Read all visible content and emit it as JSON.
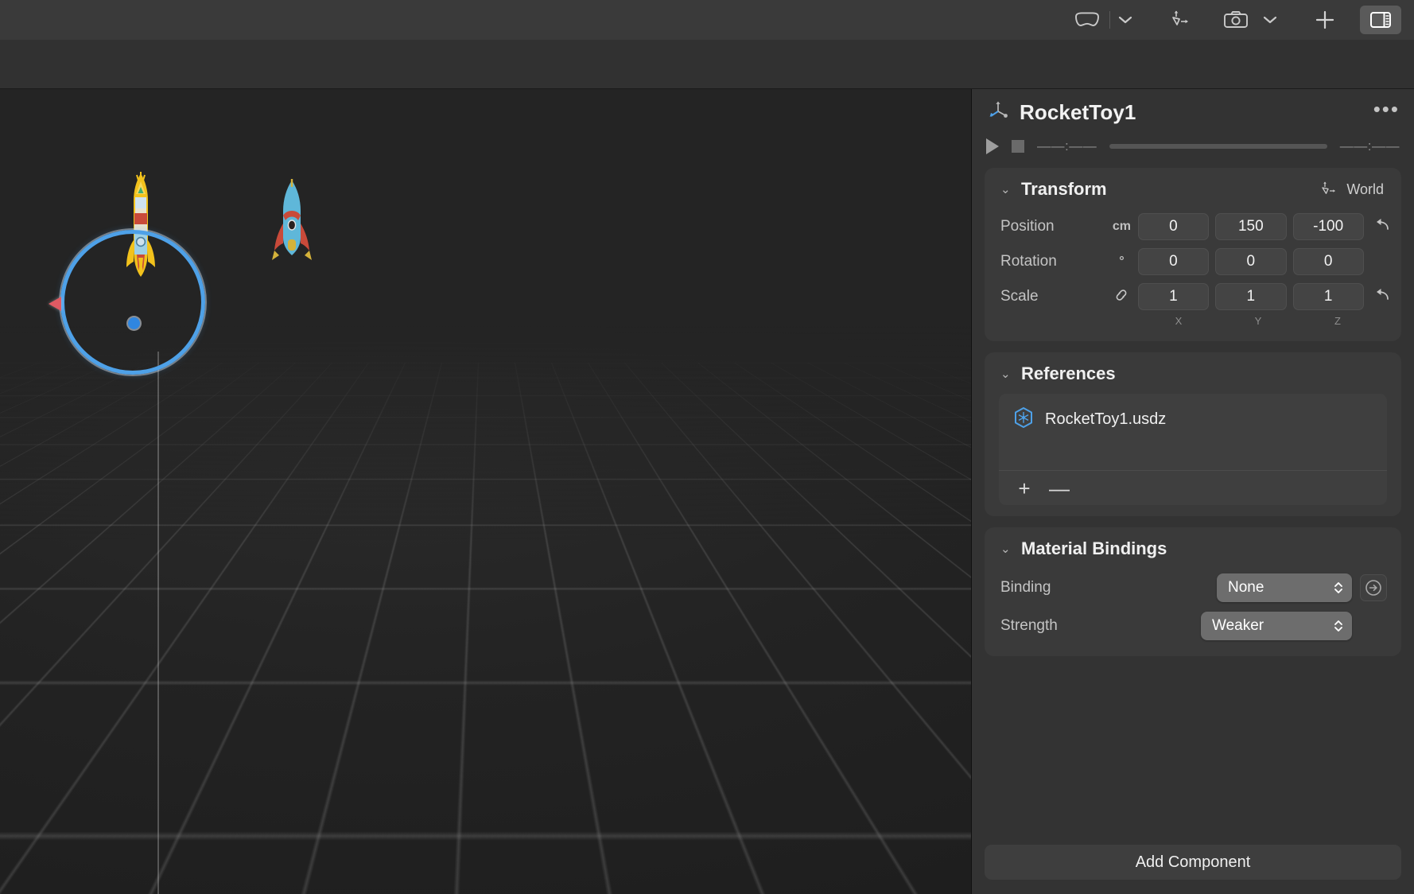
{
  "toolbar": {
    "items": [
      {
        "name": "vision-pro-device-icon",
        "label": "Vision Pro"
      },
      {
        "name": "device-chevron-down-icon",
        "label": "Device options"
      },
      {
        "name": "transform-gizmo-icon",
        "label": "Transform mode"
      },
      {
        "name": "camera-icon",
        "label": "Camera"
      },
      {
        "name": "camera-chevron-down-icon",
        "label": "Camera options"
      },
      {
        "name": "add-icon",
        "label": "Add"
      },
      {
        "name": "inspector-panel-toggle-icon",
        "label": "Toggle Inspector"
      }
    ]
  },
  "viewport": {
    "entities": [
      {
        "name": "rocket-toy-1-selected",
        "label": "RocketToy1"
      },
      {
        "name": "rocket-toy-background",
        "label": "RocketToy"
      }
    ],
    "gizmo": {
      "mode": "rotate",
      "ring_color": "#4ea1e8",
      "handle_color": "#2f86e0",
      "x_axis_color": "#e05a63"
    }
  },
  "inspector": {
    "title": "RocketToy1",
    "more_label": "•••",
    "playback": {
      "play_label": "Play",
      "stop_label": "Stop",
      "current_time": "——:——",
      "total_time": "——:——"
    },
    "transform": {
      "title": "Transform",
      "space": "World",
      "rows": [
        {
          "label": "Position",
          "unit": "cm",
          "values": [
            "0",
            "150",
            "-100"
          ],
          "revert": "↰"
        },
        {
          "label": "Rotation",
          "unit": "°",
          "values": [
            "0",
            "0",
            "0"
          ],
          "revert": ""
        },
        {
          "label": "Scale",
          "unit": "link",
          "values": [
            "1",
            "1",
            "1"
          ],
          "revert": "↰"
        }
      ],
      "axes": [
        "X",
        "Y",
        "Z"
      ]
    },
    "references": {
      "title": "References",
      "items": [
        {
          "name": "RocketToy1.usdz"
        }
      ],
      "add_label": "+",
      "remove_label": "—"
    },
    "material_bindings": {
      "title": "Material Bindings",
      "binding_label": "Binding",
      "binding_value": "None",
      "strength_label": "Strength",
      "strength_value": "Weaker"
    },
    "add_component_label": "Add Component"
  },
  "colors": {
    "accent": "#4ea1e8",
    "panel_bg": "#333333",
    "card_bg": "#3a3a3a",
    "toolbar_bg": "#3a3a3a"
  }
}
